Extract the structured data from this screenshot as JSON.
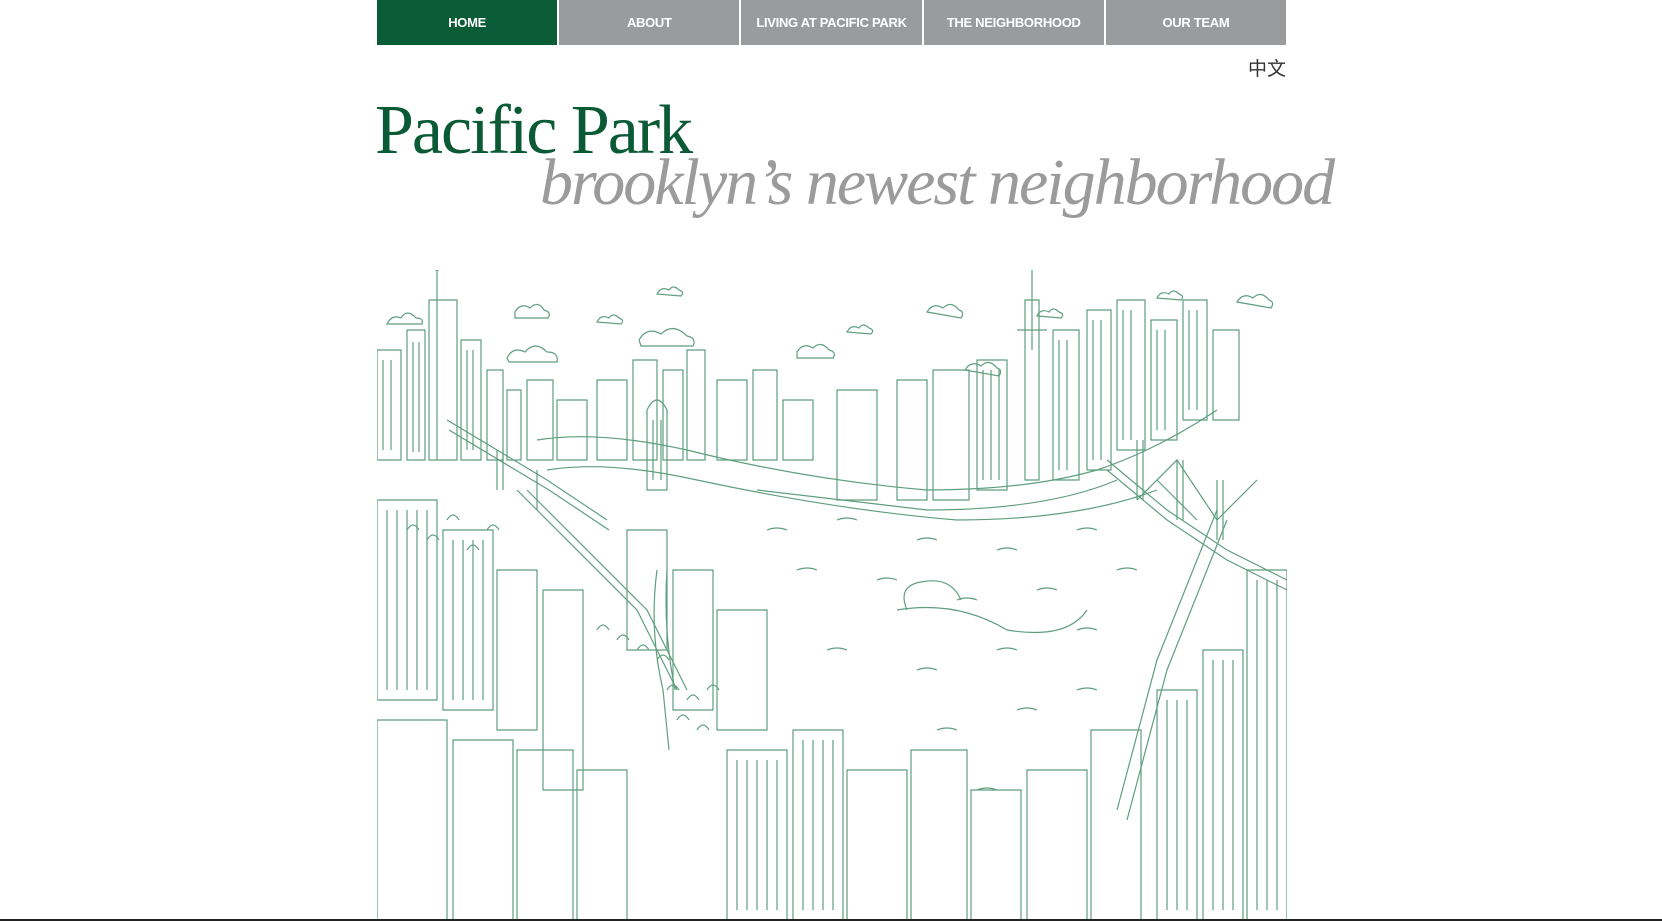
{
  "nav": {
    "items": [
      {
        "label": "HOME",
        "active": true
      },
      {
        "label": "ABOUT",
        "active": false
      },
      {
        "label": "LIVING AT PACIFIC PARK",
        "active": false
      },
      {
        "label": "THE NEIGHBORHOOD",
        "active": false
      },
      {
        "label": "OUR TEAM",
        "active": false
      }
    ]
  },
  "language_link": "中文",
  "brand": {
    "name": "Pacific Park",
    "tagline": "brooklyn’s newest neighborhood"
  },
  "colors": {
    "brand_green": "#0b5a36",
    "nav_inactive": "#9a9b9d",
    "illustration_line": "#5f9e7e",
    "tagline_gray": "#9b9b9b"
  },
  "illustration": {
    "icon": "brooklyn-skyline-line-illustration"
  }
}
